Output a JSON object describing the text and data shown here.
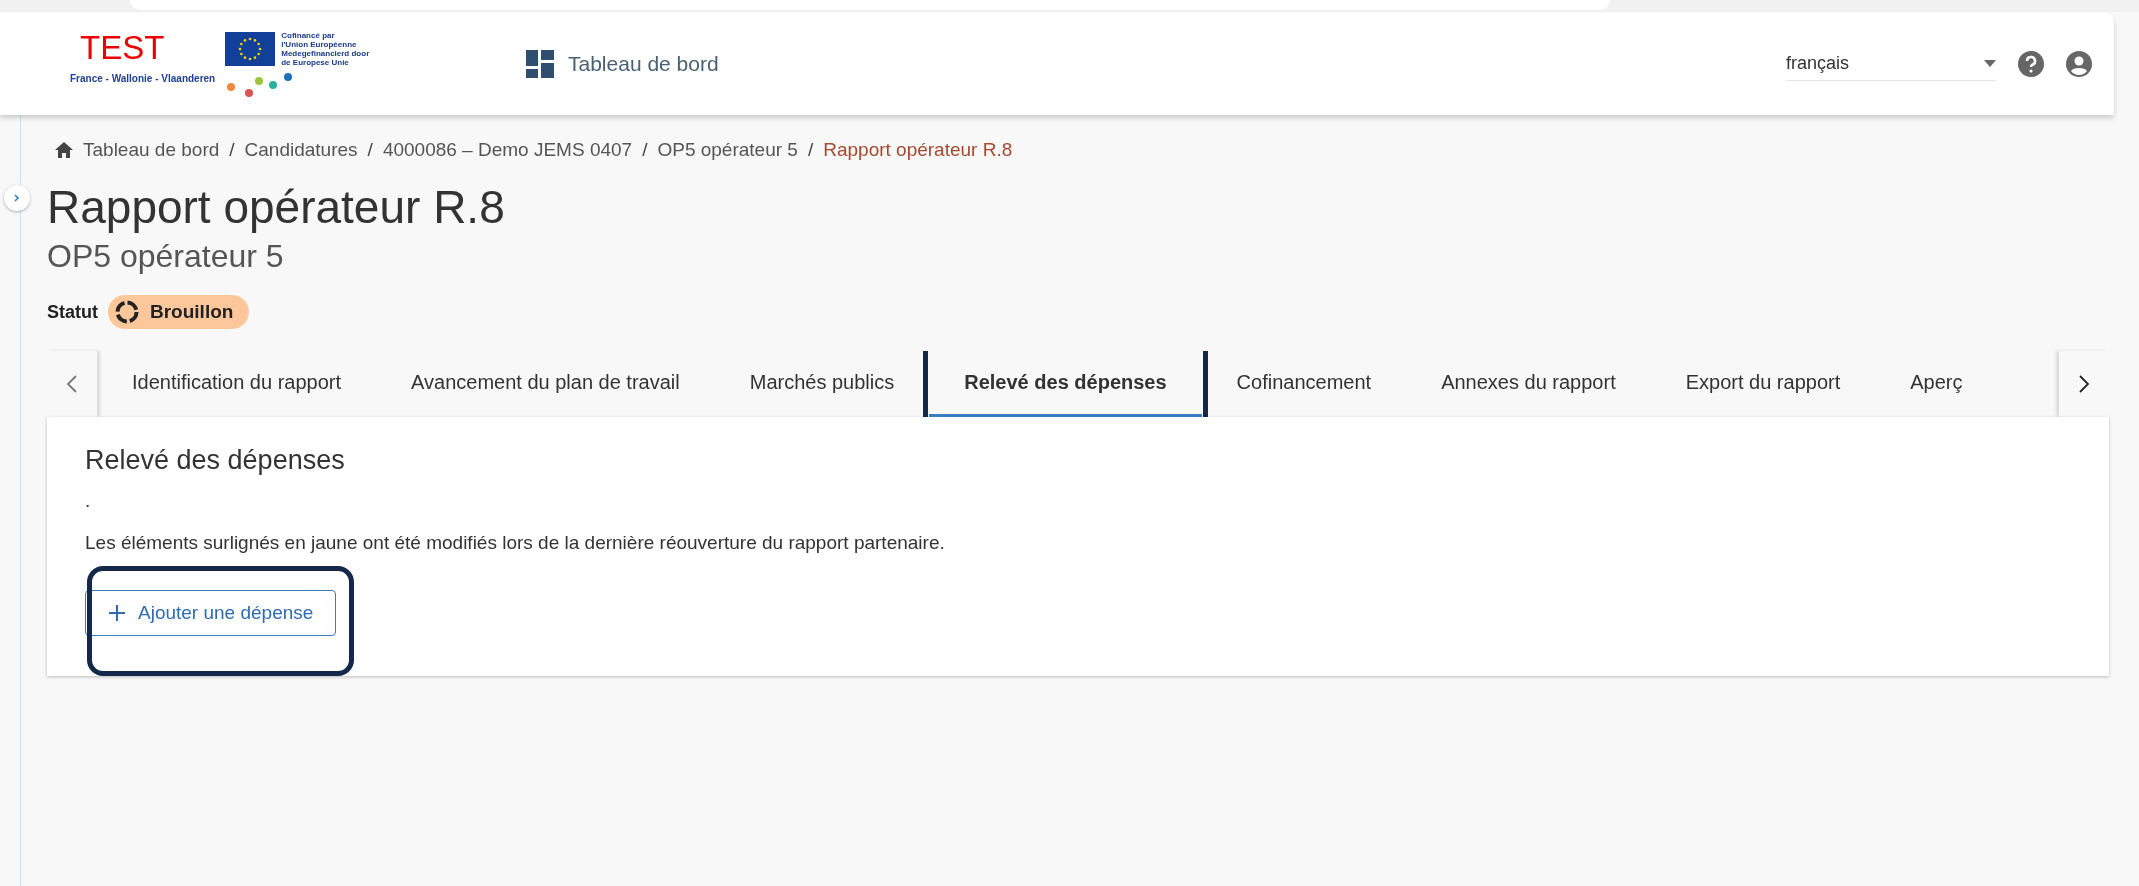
{
  "header": {
    "logo": {
      "title": "TEST",
      "eu_text": [
        "Cofinancé par",
        "l'Union Européenne",
        "Medegefinancierd door",
        "de Europese Unie"
      ],
      "region": "France - Wallonie - Vlaanderen"
    },
    "nav": {
      "label": "Tableau de bord"
    },
    "language": {
      "value": "français"
    }
  },
  "breadcrumb": [
    {
      "label": "Tableau de bord",
      "selected": false
    },
    {
      "separator": "/",
      "label": "Candidatures",
      "selected": false
    },
    {
      "separator": "/",
      "label": "4000086 – Demo JEMS 0407",
      "selected": false
    },
    {
      "separator": "/",
      "label": "OP5 opérateur 5",
      "selected": false
    },
    {
      "separator": "/",
      "label": "Rapport opérateur R.8",
      "selected": true
    }
  ],
  "page": {
    "title": "Rapport opérateur R.8",
    "subtitle": "OP5 opérateur 5",
    "status_label": "Statut",
    "status": "Brouillon"
  },
  "tabs": [
    {
      "label": "Identification du rapport",
      "selected": false,
      "highlighted": false
    },
    {
      "label": "Avancement du plan de travail",
      "selected": false,
      "highlighted": false
    },
    {
      "label": "Marchés publics",
      "selected": false,
      "highlighted": false
    },
    {
      "label": "Relevé des dépenses",
      "selected": true,
      "highlighted": true
    },
    {
      "label": "Cofinancement",
      "selected": false,
      "highlighted": false
    },
    {
      "label": "Annexes du rapport",
      "selected": false,
      "highlighted": false
    },
    {
      "label": "Export du rapport",
      "selected": false,
      "highlighted": false
    },
    {
      "label": "Aperç",
      "selected": false,
      "highlighted": false
    }
  ],
  "section": {
    "heading": "Relevé des dépenses",
    "note": ".",
    "info": "Les éléments surlignés en jaune ont été modifiés lors de la dernière réouverture du rapport partenaire.",
    "button": {
      "label": "Ajouter une dépense",
      "highlighted": true
    }
  }
}
